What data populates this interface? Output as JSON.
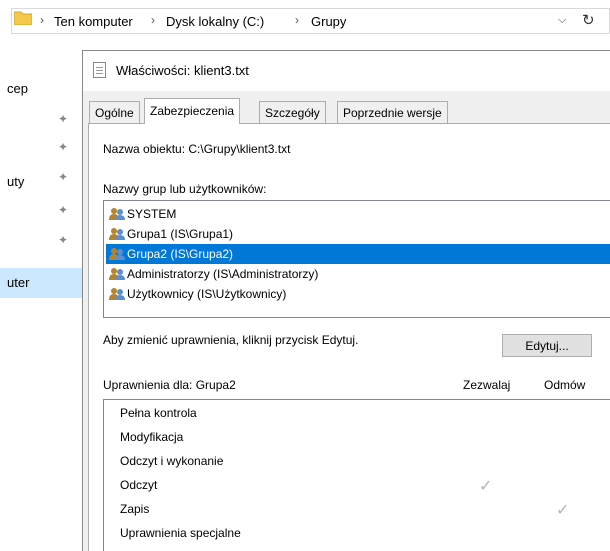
{
  "address": {
    "crumbs": [
      "Ten komputer",
      "Dysk lokalny (C:)",
      "Grupy"
    ],
    "separator": "›",
    "dropdown_glyph": "⌵",
    "refresh_glyph": "↻"
  },
  "side": {
    "items": [
      "cep",
      "uty",
      "uter"
    ],
    "pin_glyph": "✦"
  },
  "dialog": {
    "title": "Właściwości: klient3.txt",
    "tabs": [
      "Ogólne",
      "Zabezpieczenia",
      "Szczegóły",
      "Poprzednie wersje"
    ],
    "object_name": "Nazwa obiektu:  C:\\Grupy\\klient3.txt",
    "groups_label": "Nazwy grup lub użytkowników:",
    "groups": [
      {
        "name": "SYSTEM",
        "selected": false
      },
      {
        "name": "Grupa1 (IS\\Grupa1)",
        "selected": false
      },
      {
        "name": "Grupa2 (IS\\Grupa2)",
        "selected": true
      },
      {
        "name": "Administratorzy (IS\\Administratorzy)",
        "selected": false
      },
      {
        "name": "Użytkownicy (IS\\Użytkownicy)",
        "selected": false
      }
    ],
    "change_hint": "Aby zmienić uprawnienia, kliknij przycisk Edytuj.",
    "edit_button": "Edytuj...",
    "perms_label": "Uprawnienia dla: Grupa2",
    "allow_header": "Zezwalaj",
    "deny_header": "Odmów",
    "check_glyph": "✓",
    "permissions": [
      {
        "name": "Pełna kontrola",
        "allow": false,
        "deny": false
      },
      {
        "name": "Modyfikacja",
        "allow": false,
        "deny": false
      },
      {
        "name": "Odczyt i wykonanie",
        "allow": false,
        "deny": false
      },
      {
        "name": "Odczyt",
        "allow": true,
        "deny": false
      },
      {
        "name": "Zapis",
        "allow": false,
        "deny": true
      },
      {
        "name": "Uprawnienia specjalne",
        "allow": false,
        "deny": false
      }
    ]
  },
  "colors": {
    "selection": "#0078d7",
    "sidebar_selection": "#cce8ff",
    "folder": "#f2c94c",
    "user_icon_a": "#b6842c",
    "user_icon_b": "#5b8fd0"
  }
}
